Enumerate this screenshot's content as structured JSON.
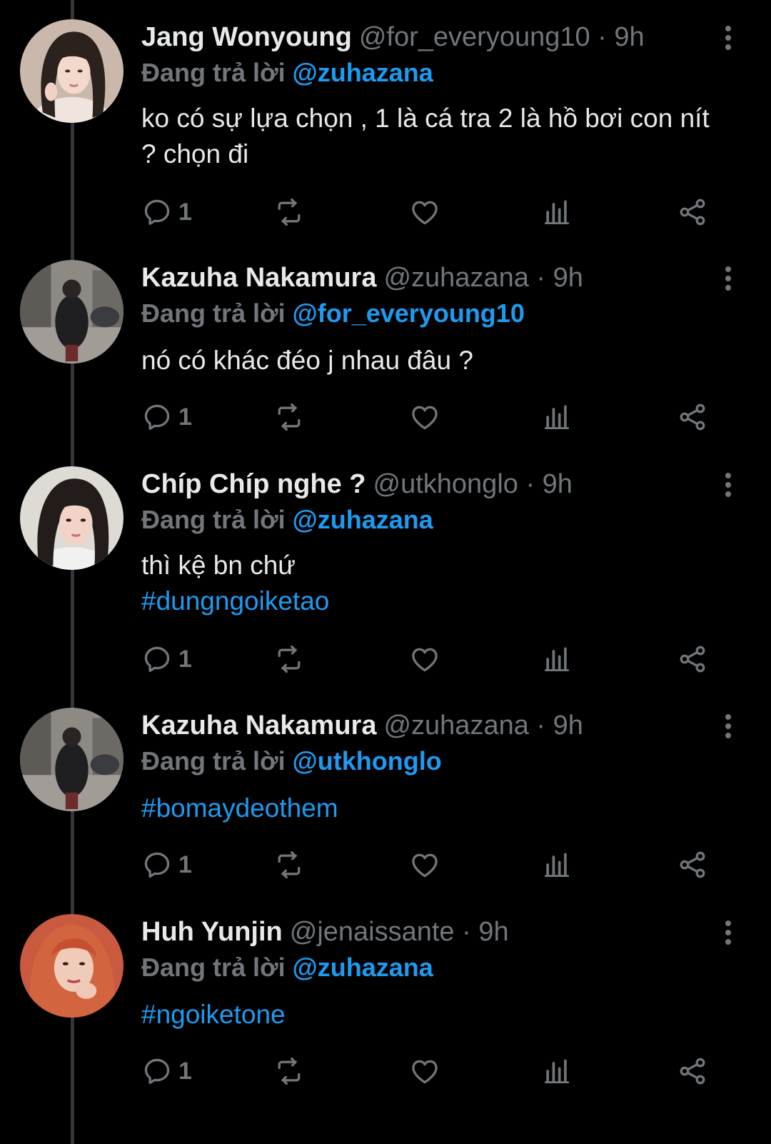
{
  "colors": {
    "background": "#000000",
    "text": "#e7e9ea",
    "muted": "#71767b",
    "accent": "#1d9bf0",
    "thread_line": "#333639"
  },
  "replying_label": "Đang trả lời",
  "icons": [
    "reply-icon",
    "retweet-icon",
    "like-icon",
    "views-icon",
    "share-icon",
    "more-icon"
  ],
  "tweets": [
    {
      "name": "Jang Wonyoung",
      "meta": "@for_everyoung10 · 9h",
      "replying_to": "@zuhazana",
      "text": "ko có sự lựa chọn , 1 là cá tra 2 là hồ bơi con nít ? chọn đi",
      "hashtag": "",
      "reply_count": "1"
    },
    {
      "name": "Kazuha Nakamura",
      "meta": "@zuhazana · 9h",
      "replying_to": "@for_everyoung10",
      "text": "nó có khác đéo j nhau đâu ?",
      "hashtag": "",
      "reply_count": "1"
    },
    {
      "name": "Chíp Chíp nghe ?",
      "meta": "@utkhonglo · 9h",
      "replying_to": "@zuhazana",
      "text": "thì kệ bn chứ",
      "hashtag": "#dungngoiketao",
      "reply_count": "1"
    },
    {
      "name": "Kazuha Nakamura",
      "meta": "@zuhazana · 9h",
      "replying_to": "@utkhonglo",
      "text": "",
      "hashtag": "#bomaydeothem",
      "reply_count": "1"
    },
    {
      "name": "Huh Yunjin",
      "meta": "@jenaissante · 9h",
      "replying_to": "@zuhazana",
      "text": "",
      "hashtag": "#ngoiketone",
      "reply_count": "1"
    }
  ]
}
